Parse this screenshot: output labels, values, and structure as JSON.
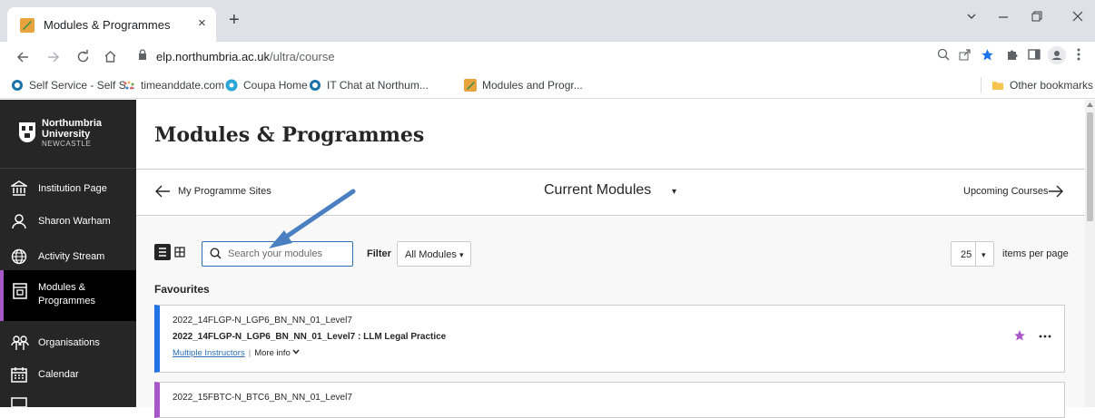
{
  "browser": {
    "tab_title": "Modules & Programmes",
    "tab_close": "×",
    "new_tab": "+",
    "url_host": "elp.northumbria.ac.uk",
    "url_path": "/ultra/course",
    "bookmarks": [
      {
        "label": "Self Service - Self S...",
        "icon": "circle-icon",
        "color": "#1a73a8"
      },
      {
        "label": "timeanddate.com",
        "icon": "dots-icon",
        "color": "#e06666"
      },
      {
        "label": "Coupa Home",
        "icon": "coupa-icon",
        "color": "#2aa6d8"
      },
      {
        "label": "IT Chat at Northum...",
        "icon": "circle-icon",
        "color": "#1a73a8"
      },
      {
        "label": "Modules and Progr...",
        "icon": "blackboard-icon",
        "color": "#e8a33c"
      }
    ],
    "other_bookmarks": "Other bookmarks"
  },
  "sidebar": {
    "logo": {
      "line1": "Northumbria",
      "line2": "University",
      "line3": "NEWCASTLE"
    },
    "items": [
      {
        "label": "Institution Page",
        "icon": "institution-icon"
      },
      {
        "label": "Sharon Warham",
        "icon": "user-icon"
      },
      {
        "label": "Activity Stream",
        "icon": "globe-icon"
      },
      {
        "label": "Modules &",
        "label2": "Programmes",
        "icon": "modules-icon",
        "active": true
      },
      {
        "label": "Organisations",
        "icon": "organisations-icon"
      },
      {
        "label": "Calendar",
        "icon": "calendar-icon"
      }
    ],
    "accent": "#a857c9"
  },
  "main": {
    "title": "Modules & Programmes",
    "subnav": {
      "back_label": "My Programme Sites",
      "current": "Current Modules",
      "current_caret": "▾",
      "upcoming": "Upcoming Courses"
    },
    "search": {
      "placeholder": "Search your modules",
      "value": ""
    },
    "filter": {
      "label": "Filter",
      "value": "All Modules",
      "caret": "▾"
    },
    "pagination": {
      "per_page": "25",
      "caret": "▾",
      "label": "items per page"
    },
    "favourites_heading": "Favourites",
    "courses": [
      {
        "code": "2022_14FLGP-N_LGP6_BN_NN_01_Level7",
        "name": "2022_14FLGP-N_LGP6_BN_NN_01_Level7 : LLM Legal Practice",
        "instructors": "Multiple Instructors",
        "more_info": "More info",
        "color": "#2273e6"
      },
      {
        "code": "2022_15FBTC-N_BTC6_BN_NN_01_Level7",
        "color": "#a857c9"
      }
    ]
  },
  "colors": {
    "link": "#2d6db3",
    "favourite_star": "#a857c9",
    "annotation_arrow": "#4a7fc1"
  }
}
